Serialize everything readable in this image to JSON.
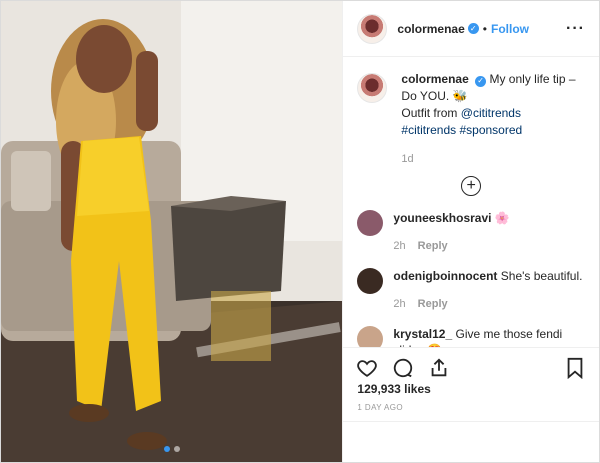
{
  "post": {
    "username": "colormenae",
    "follow_label": "Follow",
    "separator": "•",
    "more_label": "···"
  },
  "caption": {
    "username": "colormenae",
    "text_1": "My only life tip – Do YOU. 🐝",
    "text_2": "Outfit from",
    "mention": "@cititrends",
    "hashtag_1": "#cititrends",
    "hashtag_2": "#sponsored",
    "timestamp": "1d",
    "load_more": "+"
  },
  "comments": [
    {
      "username": "youneeskhosravi",
      "text": "🌸",
      "time": "2h",
      "reply": "Reply",
      "avatar_color": "#8a5a6a"
    },
    {
      "username": "odenigboinnocent",
      "text": "She's beautiful.",
      "time": "2h",
      "reply": "Reply",
      "avatar_color": "#3a2a22"
    },
    {
      "username": "krystal12_",
      "text": "Give me those fendi slides 😍",
      "time": "",
      "reply": "",
      "avatar_color": "#c9a48a"
    }
  ],
  "engagement": {
    "likes": "129,933 likes",
    "date": "1 DAY AGO"
  },
  "colors": {
    "accent": "#3897f0",
    "outfit": "#f2c218"
  },
  "icons": [
    "heart-icon",
    "comment-icon",
    "share-icon",
    "bookmark-icon",
    "verified-badge-icon",
    "add-circle-icon",
    "more-options-icon"
  ]
}
